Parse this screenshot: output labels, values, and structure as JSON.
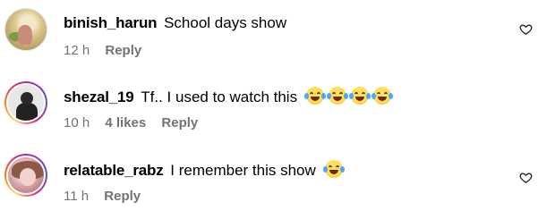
{
  "comments": [
    {
      "username": "binish_harun",
      "text": "School days show",
      "time": "12 h",
      "reply_label": "Reply",
      "avatar_story_ring": false,
      "emoji": []
    },
    {
      "username": "shezal_19",
      "text": "Tf.. I used to watch this",
      "time": "10 h",
      "likes": "4 likes",
      "reply_label": "Reply",
      "avatar_story_ring": true,
      "emoji": [
        "face-with-tears-of-joy",
        "face-with-tears-of-joy",
        "face-with-tears-of-joy",
        "face-with-tears-of-joy"
      ]
    },
    {
      "username": "relatable_rabz",
      "text": "I remember this show",
      "time": "11 h",
      "reply_label": "Reply",
      "avatar_story_ring": true,
      "emoji": [
        "face-with-tears-of-joy"
      ]
    }
  ],
  "icons": {
    "like": "heart-outline-icon"
  },
  "colors": {
    "meta_text": "#737373",
    "primary_text": "#000000",
    "story_ring": [
      "#feda75",
      "#fa7e1e",
      "#d62976",
      "#962fbf",
      "#4f5bd5"
    ]
  }
}
